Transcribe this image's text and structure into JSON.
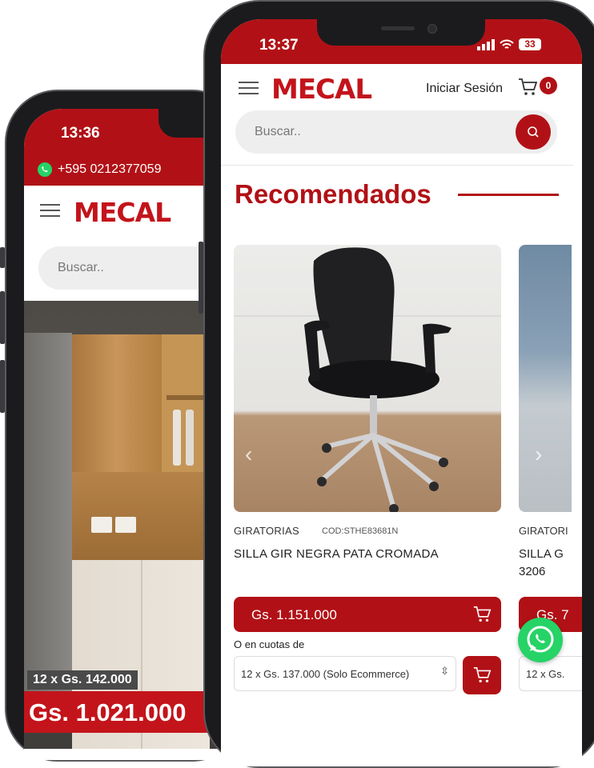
{
  "back_phone": {
    "time": "13:36",
    "phone": "+595 0212377059",
    "logo": "MECAL",
    "search_placeholder": "Buscar..",
    "installment": "12 x Gs. 142.000",
    "price": "Gs. 1.021.000"
  },
  "front_phone": {
    "time": "13:37",
    "battery": "33",
    "logo": "MECAL",
    "login_label": "Iniciar Sesión",
    "cart_count": "0",
    "search_placeholder": "Buscar..",
    "section_title": "Recomendados",
    "products": [
      {
        "category": "GIRATORIAS",
        "code": "COD:STHE83681N",
        "name": "SILLA GIR NEGRA PATA CROMADA",
        "price": "Gs. 1.151.000",
        "installments_label": "O en cuotas de",
        "installment_option": "12 x Gs. 137.000 (Solo Ecommerce)"
      },
      {
        "category": "GIRATORI",
        "name_line1": "SILLA G",
        "name_line2": "3206",
        "price": "Gs. 7",
        "installment_option": "12 x Gs."
      }
    ]
  },
  "colors": {
    "brand_red": "#b11116",
    "whatsapp_green": "#25d366"
  },
  "icons": [
    "whatsapp-icon",
    "hamburger-menu-icon",
    "cart-icon",
    "search-icon",
    "chevron-left-icon",
    "chevron-right-icon",
    "signal-icon",
    "wifi-icon",
    "battery-icon"
  ]
}
